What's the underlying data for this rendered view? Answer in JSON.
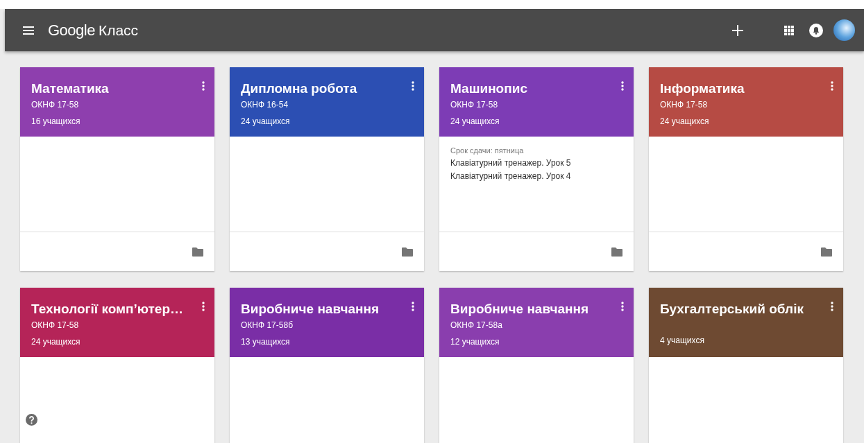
{
  "app_bar": {
    "logo": "Google",
    "product": "Класс"
  },
  "classes": [
    {
      "title": "Математика",
      "section": "ОКНФ 17-58",
      "students": "16 учащихся",
      "color": "#8e3fae"
    },
    {
      "title": "Дипломна робота",
      "section": "ОКНФ 16-54",
      "students": "24 учащихся",
      "color": "#2c4fb3"
    },
    {
      "title": "Машинопис",
      "section": "ОКНФ 17-58",
      "students": "24 учащихся",
      "color": "#7d3cb5",
      "due": "Срок сдачи: пятница",
      "assignments": [
        "Клавіатурний тренажер. Урок 5",
        "Клавіатурний тренажер. Урок 4"
      ]
    },
    {
      "title": "Інформатика",
      "section": "ОКНФ 17-58",
      "students": "24 учащихся",
      "color": "#b64b44"
    },
    {
      "title": "Технології комп’ютер…",
      "section": "ОКНФ 17-58",
      "students": "24 учащихся",
      "color": "#b52458"
    },
    {
      "title": "Виробниче навчання",
      "section": "ОКНФ 17-58б",
      "students": "13 учащихся",
      "color": "#7a2ea6"
    },
    {
      "title": "Виробниче навчання",
      "section": "ОКНФ 17-58а",
      "students": "12 учащихся",
      "color": "#8a3eae"
    },
    {
      "title": "Бухгалтерський облік",
      "students": "4 учащихся",
      "color": "#6e4a32"
    }
  ]
}
